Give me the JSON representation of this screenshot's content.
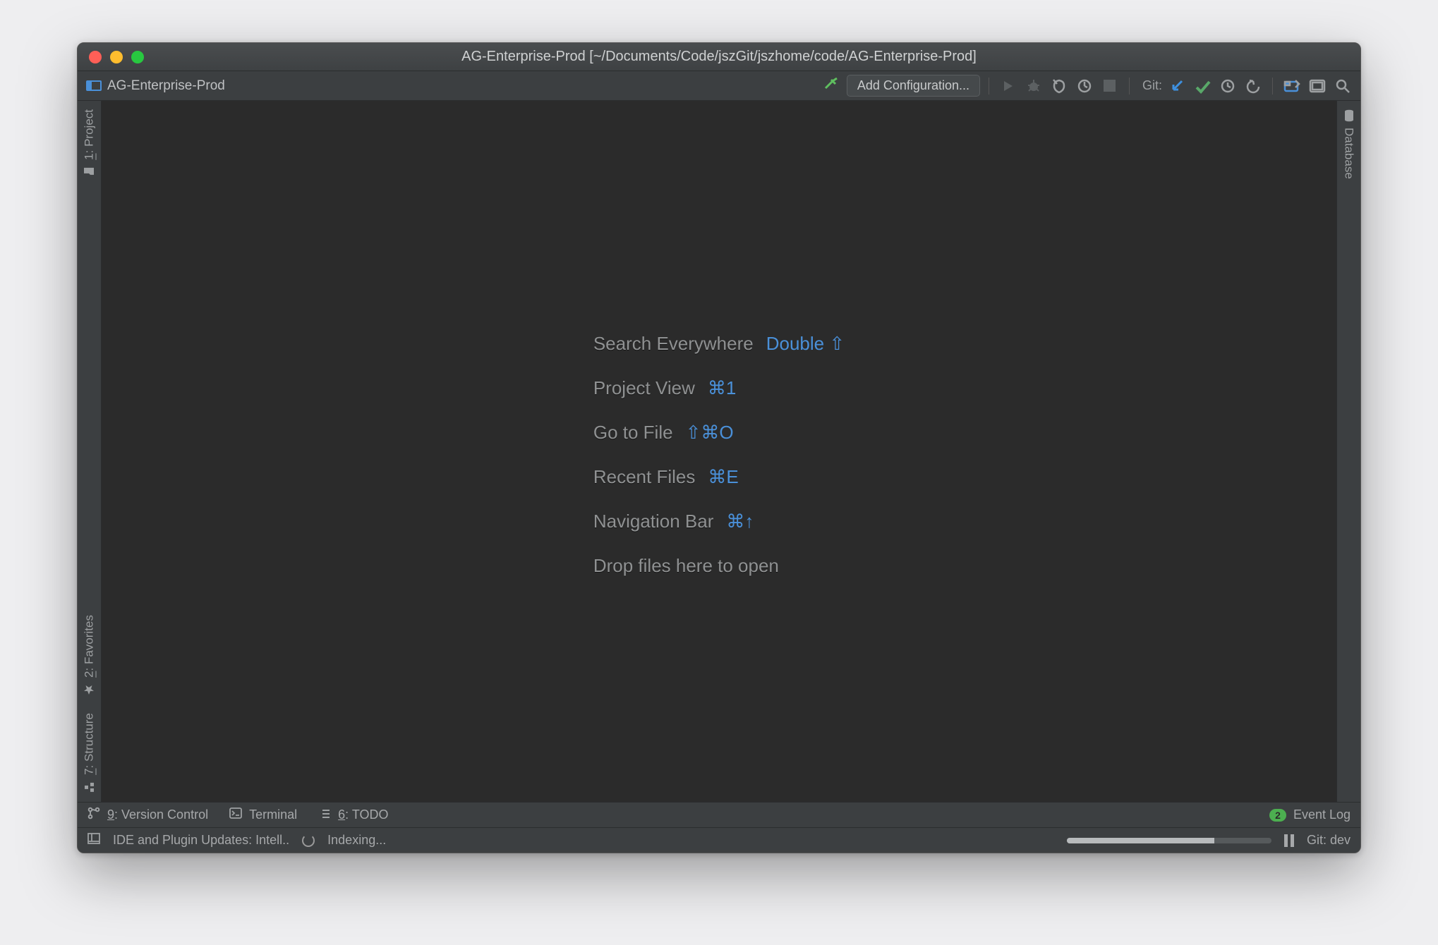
{
  "window": {
    "title": "AG-Enterprise-Prod [~/Documents/Code/jszGit/jszhome/code/AG-Enterprise-Prod]",
    "project_name": "AG-Enterprise-Prod"
  },
  "toolbar": {
    "add_configuration": "Add Configuration...",
    "git_label": "Git:"
  },
  "left_gutter": {
    "project": {
      "prefix": "1",
      "label": ": Project"
    },
    "favorites": {
      "prefix": "2",
      "label": ": Favorites"
    },
    "structure": {
      "prefix": "7",
      "label": ": Structure"
    }
  },
  "right_gutter": {
    "database": "Database"
  },
  "editor_shortcuts": [
    {
      "label": "Search Everywhere",
      "key": "Double ⇧"
    },
    {
      "label": "Project View",
      "key": "⌘1"
    },
    {
      "label": "Go to File",
      "key": "⇧⌘O"
    },
    {
      "label": "Recent Files",
      "key": "⌘E"
    },
    {
      "label": "Navigation Bar",
      "key": "⌘↑"
    }
  ],
  "editor_drop_hint": "Drop files here to open",
  "bottombar": {
    "version_control": {
      "prefix": "9",
      "label": ": Version Control"
    },
    "terminal": "Terminal",
    "todo": {
      "prefix": "6",
      "label": ": TODO"
    },
    "event_log": "Event Log",
    "event_badge": "2"
  },
  "statusbar": {
    "updates": "IDE and Plugin Updates: Intell..",
    "indexing": "Indexing...",
    "progress_percent": 72,
    "git_branch": "Git: dev"
  }
}
